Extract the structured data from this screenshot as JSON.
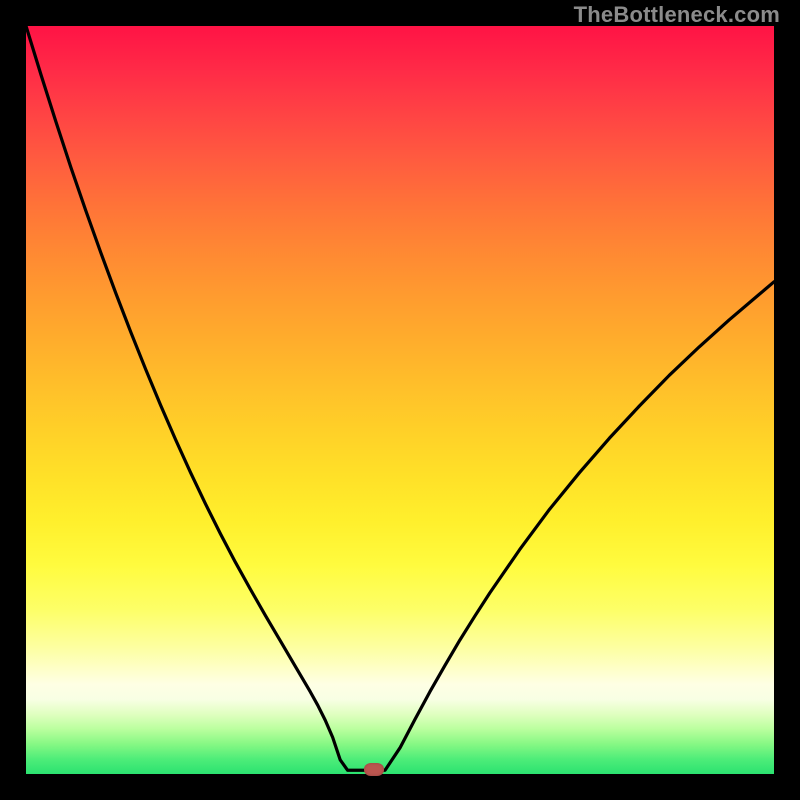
{
  "watermark": {
    "text": "TheBottleneck.com"
  },
  "colors": {
    "frame": "#000000",
    "curve_stroke": "#000000",
    "marker_fill": "#bb554f",
    "gradient_top": "#ff1345",
    "gradient_bottom": "#2be270"
  },
  "chart_data": {
    "type": "line",
    "title": "",
    "xlabel": "",
    "ylabel": "",
    "xlim": [
      0,
      100
    ],
    "ylim": [
      0,
      100
    ],
    "grid": false,
    "legend": false,
    "annotations": [
      "TheBottleneck.com"
    ],
    "series": [
      {
        "name": "bottleneck-curve",
        "x": [
          0,
          2,
          4,
          6,
          8,
          10,
          12,
          14,
          16,
          18,
          20,
          22,
          24,
          26,
          28,
          30,
          32,
          34,
          36,
          38,
          39,
          40,
          41,
          42,
          43,
          44,
          46,
          48,
          50,
          52,
          54,
          56,
          58,
          60,
          62,
          66,
          70,
          74,
          78,
          82,
          86,
          90,
          94,
          98,
          100
        ],
        "values": [
          100,
          93.5,
          87.2,
          81.1,
          75.3,
          69.7,
          64.3,
          59.1,
          54.1,
          49.3,
          44.7,
          40.3,
          36.1,
          32.1,
          28.3,
          24.7,
          21.2,
          17.8,
          14.4,
          11.0,
          9.2,
          7.2,
          4.9,
          1.9,
          0.5,
          0.5,
          0.5,
          0.5,
          3.5,
          7.3,
          11.0,
          14.5,
          17.9,
          21.1,
          24.2,
          30.0,
          35.4,
          40.3,
          44.9,
          49.2,
          53.3,
          57.1,
          60.7,
          64.1,
          65.8
        ]
      }
    ],
    "marker": {
      "x": 46.5,
      "y": 0.5
    }
  }
}
